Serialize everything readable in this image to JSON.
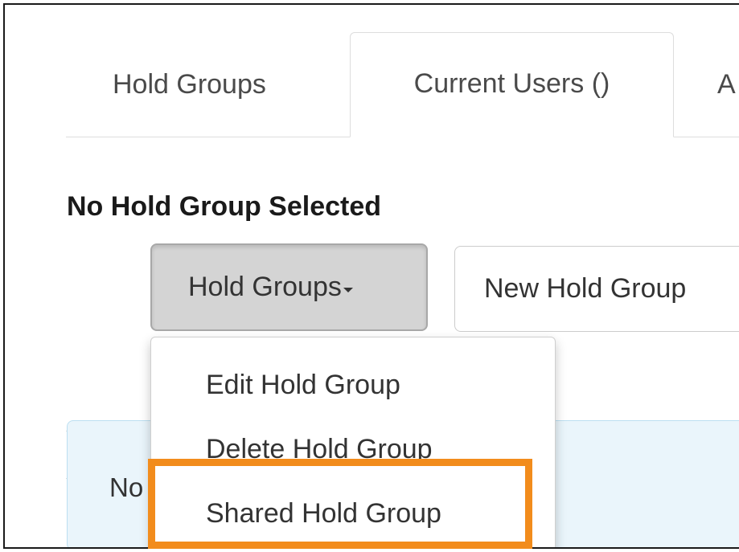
{
  "tabs": [
    {
      "label": "Hold Groups"
    },
    {
      "label": "Current Users ()"
    },
    {
      "label": "A"
    }
  ],
  "heading": "No Hold Group Selected",
  "toolbar": {
    "hold_groups_label": "Hold Groups",
    "new_hold_group_label": "New Hold Group"
  },
  "dropdown": {
    "items": [
      {
        "label": "Edit Hold Group"
      },
      {
        "label": "Delete Hold Group"
      },
      {
        "label": "Shared Hold Group"
      }
    ]
  },
  "table": {
    "columns": [
      "#"
    ],
    "info_text": "No"
  },
  "colors": {
    "highlight": "#f28c1c",
    "selected_button_bg": "#d4d4d4",
    "info_row_bg": "#eaf5fb"
  },
  "icons": {
    "dropdown_indicator": "caret-down-icon"
  }
}
